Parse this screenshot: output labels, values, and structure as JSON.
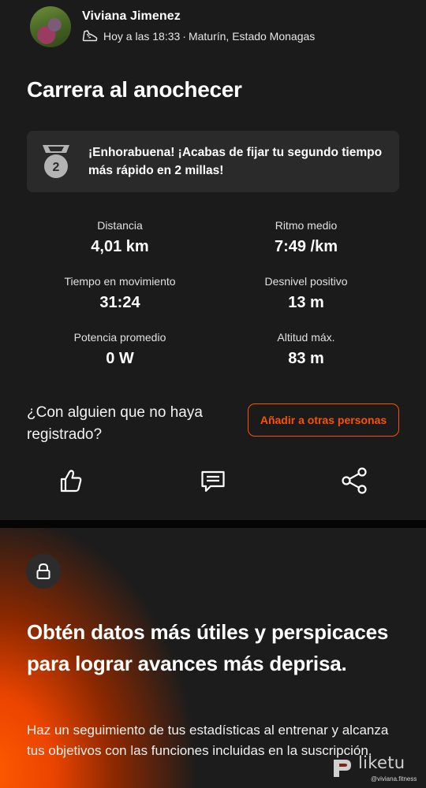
{
  "activity": {
    "user_name": "Viviana Jimenez",
    "time": "Hoy a las 18:33",
    "separator": "·",
    "location": "Maturín, Estado Monagas",
    "title": "Carrera al anochecer",
    "achievement": {
      "medal_number": "2",
      "text": "¡Enhorabuena! ¡Acabas de fijar tu segundo tiempo más rápido en 2 millas!"
    },
    "stats": [
      {
        "label": "Distancia",
        "value": "4,01 km"
      },
      {
        "label": "Ritmo medio",
        "value": "7:49 /km"
      },
      {
        "label": "Tiempo en movimiento",
        "value": "31:24"
      },
      {
        "label": "Desnivel positivo",
        "value": "13 m"
      },
      {
        "label": "Potencia promedio",
        "value": "0 W"
      },
      {
        "label": "Altitud máx.",
        "value": "83 m"
      }
    ],
    "others_question": "¿Con alguien que no haya registrado?",
    "add_others_label": "Añadir a otras personas",
    "actions": {
      "like_icon": "thumbs-up-icon",
      "comment_icon": "comment-icon",
      "share_icon": "share-icon"
    }
  },
  "promo": {
    "lock_icon": "lock-icon",
    "heading": "Obtén datos más útiles y perspicaces para lograr avances más deprisa.",
    "body": "Haz un seguimiento de tus estadísticas al entrenar y alcanza tus objetivos con las funciones incluidas en la suscripción."
  },
  "watermark": {
    "brand": "liketu",
    "handle": "@viviana.fitness"
  },
  "colors": {
    "accent": "#fc5200",
    "background": "#1b1b1b",
    "card": "#2a2a2a"
  }
}
